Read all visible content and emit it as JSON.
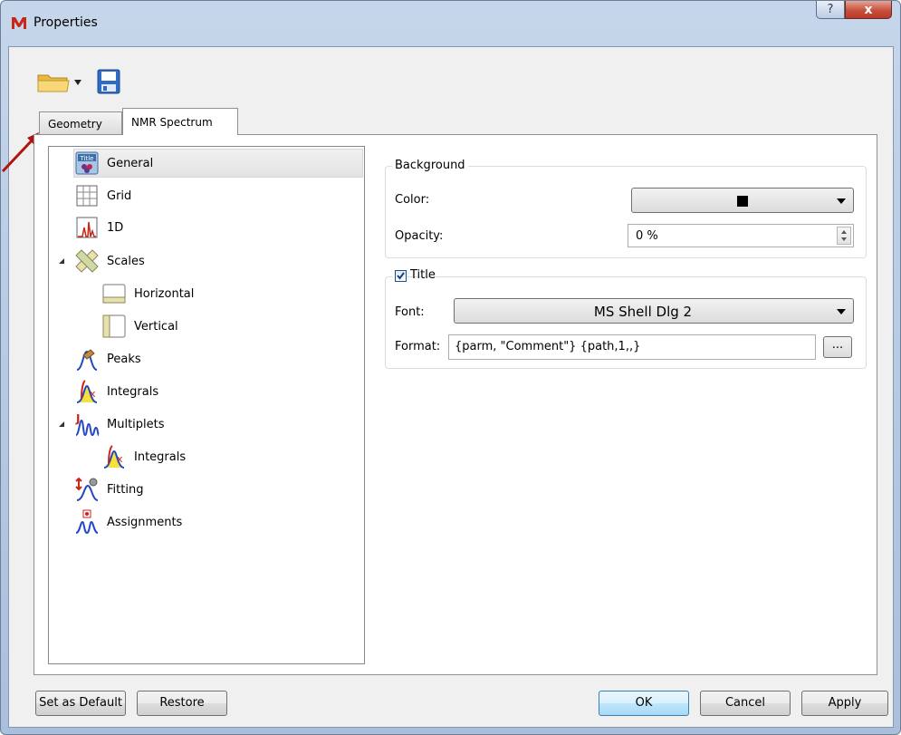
{
  "window": {
    "title": "Properties",
    "help_label": "?",
    "close_label": "x"
  },
  "tabs": [
    {
      "label": "Geometry"
    },
    {
      "label": "NMR Spectrum"
    }
  ],
  "tree": {
    "items": [
      {
        "label": "General"
      },
      {
        "label": "Grid"
      },
      {
        "label": "1D"
      },
      {
        "label": "Scales"
      },
      {
        "label": "Horizontal"
      },
      {
        "label": "Vertical"
      },
      {
        "label": "Peaks"
      },
      {
        "label": "Integrals"
      },
      {
        "label": "Multiplets"
      },
      {
        "label": "Integrals"
      },
      {
        "label": "Fitting"
      },
      {
        "label": "Assignments"
      }
    ],
    "selected": "General"
  },
  "background": {
    "group_label": "Background",
    "color_label": "Color:",
    "color_value": "#000000",
    "opacity_label": "Opacity:",
    "opacity_value": "0 %"
  },
  "title_group": {
    "label": "Title",
    "checked": true,
    "font_label": "Font:",
    "font_value": "MS Shell Dlg 2",
    "format_label": "Format:",
    "format_value": "{parm, \"Comment\"} {path,1,,}",
    "browse_label": "..."
  },
  "buttons": {
    "set_default": "Set as Default",
    "restore": "Restore",
    "ok": "OK",
    "cancel": "Cancel",
    "apply": "Apply"
  },
  "icons": {
    "app": "mnova-icon",
    "open": "folder-open-icon",
    "save": "save-icon"
  }
}
